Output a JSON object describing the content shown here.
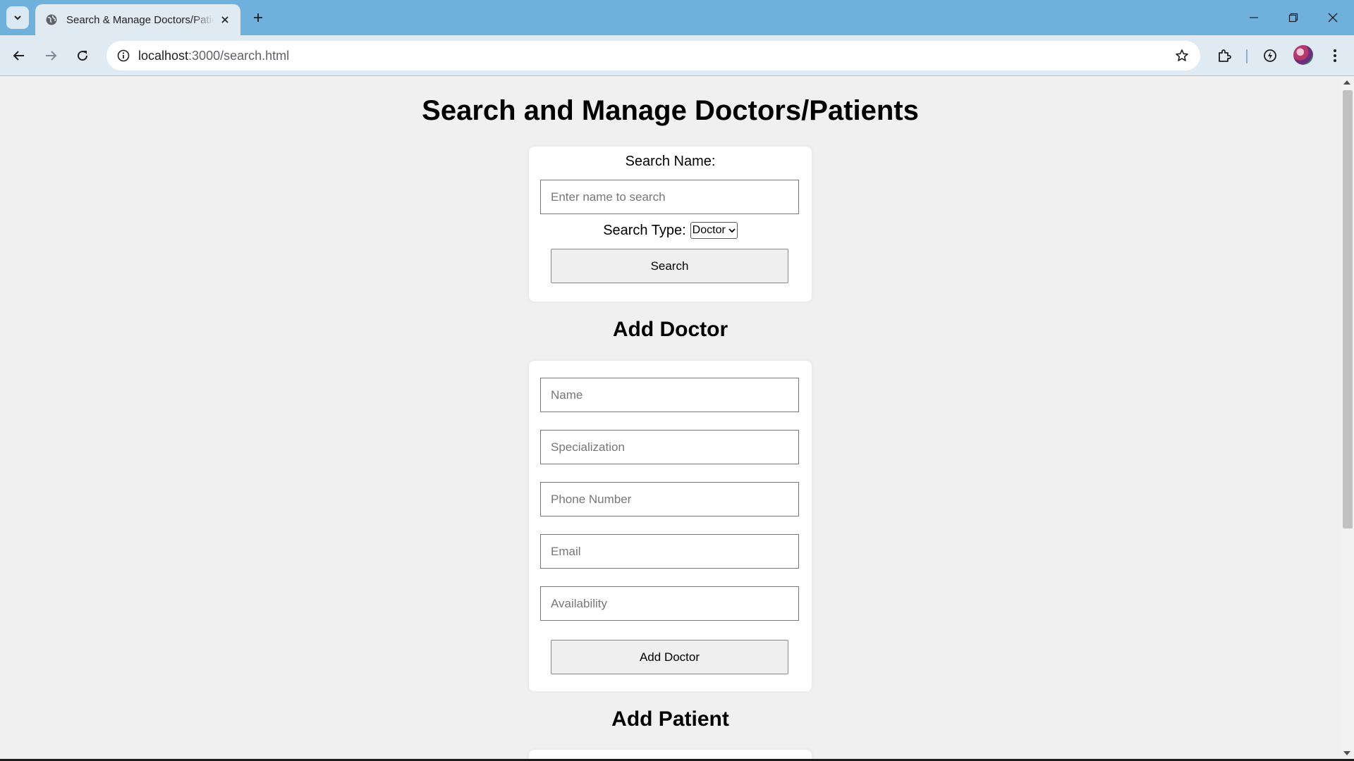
{
  "browser": {
    "tab_title": "Search & Manage Doctors/Patients",
    "url_host": "localhost",
    "url_path": ":3000/search.html"
  },
  "page": {
    "title": "Search and Manage Doctors/Patients",
    "search": {
      "name_label": "Search Name:",
      "name_placeholder": "Enter name to search",
      "type_label": "Search Type:",
      "type_selected": "Doctor",
      "button": "Search"
    },
    "add_doctor": {
      "heading": "Add Doctor",
      "name_placeholder": "Name",
      "specialization_placeholder": "Specialization",
      "phone_placeholder": "Phone Number",
      "email_placeholder": "Email",
      "availability_placeholder": "Availability",
      "button": "Add Doctor"
    },
    "add_patient": {
      "heading": "Add Patient"
    }
  }
}
